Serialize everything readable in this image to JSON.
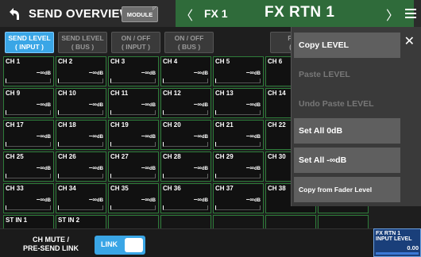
{
  "header": {
    "title": "SEND OVERVIEW",
    "module_label": "MODULE",
    "fx_name": "FX 1",
    "fx_label": "FX RTN 1"
  },
  "tabs": [
    {
      "line1": "SEND LEVEL",
      "line2": "( INPUT )",
      "active": true
    },
    {
      "line1": "SEND LEVEL",
      "line2": "( BUS )",
      "active": false
    },
    {
      "line1": "ON / OFF",
      "line2": "( INPUT )",
      "active": false
    },
    {
      "line1": "ON / OFF",
      "line2": "( BUS )",
      "active": false
    },
    {
      "line1": "PRE",
      "line2": "( IN",
      "active": false
    }
  ],
  "channels": [
    {
      "name": "CH 1",
      "value": "−∞",
      "unit": "dB"
    },
    {
      "name": "CH 2",
      "value": "−∞",
      "unit": "dB"
    },
    {
      "name": "CH 3",
      "value": "−∞",
      "unit": "dB"
    },
    {
      "name": "CH 4",
      "value": "−∞",
      "unit": "dB"
    },
    {
      "name": "CH 5",
      "value": "−∞",
      "unit": "dB"
    },
    {
      "name": "CH 6",
      "value": "",
      "unit": ""
    },
    {
      "name": "CH 9",
      "value": "−∞",
      "unit": "dB"
    },
    {
      "name": "CH 10",
      "value": "−∞",
      "unit": "dB"
    },
    {
      "name": "CH 11",
      "value": "−∞",
      "unit": "dB"
    },
    {
      "name": "CH 12",
      "value": "−∞",
      "unit": "dB"
    },
    {
      "name": "CH 13",
      "value": "−∞",
      "unit": "dB"
    },
    {
      "name": "CH 14",
      "value": "",
      "unit": ""
    },
    {
      "name": "CH 17",
      "value": "−∞",
      "unit": "dB"
    },
    {
      "name": "CH 18",
      "value": "−∞",
      "unit": "dB"
    },
    {
      "name": "CH 19",
      "value": "−∞",
      "unit": "dB"
    },
    {
      "name": "CH 20",
      "value": "−∞",
      "unit": "dB"
    },
    {
      "name": "CH 21",
      "value": "−∞",
      "unit": "dB"
    },
    {
      "name": "CH 22",
      "value": "",
      "unit": ""
    },
    {
      "name": "CH 25",
      "value": "−∞",
      "unit": "dB"
    },
    {
      "name": "CH 26",
      "value": "−∞",
      "unit": "dB"
    },
    {
      "name": "CH 27",
      "value": "−∞",
      "unit": "dB"
    },
    {
      "name": "CH 28",
      "value": "−∞",
      "unit": "dB"
    },
    {
      "name": "CH 29",
      "value": "−∞",
      "unit": "dB"
    },
    {
      "name": "CH 30",
      "value": "",
      "unit": ""
    },
    {
      "name": "CH 33",
      "value": "−∞",
      "unit": "dB"
    },
    {
      "name": "CH 34",
      "value": "−∞",
      "unit": "dB"
    },
    {
      "name": "CH 35",
      "value": "−∞",
      "unit": "dB"
    },
    {
      "name": "CH 36",
      "value": "−∞",
      "unit": "dB"
    },
    {
      "name": "CH 37",
      "value": "−∞",
      "unit": "dB"
    },
    {
      "name": "CH 38",
      "value": "",
      "unit": ""
    },
    {
      "name": "ST IN 1",
      "value": "−∞",
      "unit": "dB"
    },
    {
      "name": "ST IN 2",
      "value": "−∞",
      "unit": "dB"
    }
  ],
  "bottom": {
    "mute_label_line1": "CH MUTE /",
    "mute_label_line2": "PRE-SEND LINK",
    "link_label": "LINK",
    "link_on": true,
    "fx_level_line1": "FX RTN 1",
    "fx_level_line2": "INPUT LEVEL",
    "fx_level_value": "0.00"
  },
  "popup": {
    "items": [
      {
        "label": "Copy LEVEL",
        "enabled": true
      },
      {
        "label": "Paste LEVEL",
        "enabled": false
      },
      {
        "label": "Undo Paste LEVEL",
        "enabled": false
      },
      {
        "label": "Set All 0dB",
        "enabled": true
      },
      {
        "label": "Set All -∞dB",
        "enabled": true
      },
      {
        "label": "Copy from Fader Level",
        "enabled": true
      }
    ]
  },
  "colors": {
    "accent": "#3aa6e6",
    "fx_header": "#2f6b3a",
    "grid_border": "#2e7d3a"
  }
}
